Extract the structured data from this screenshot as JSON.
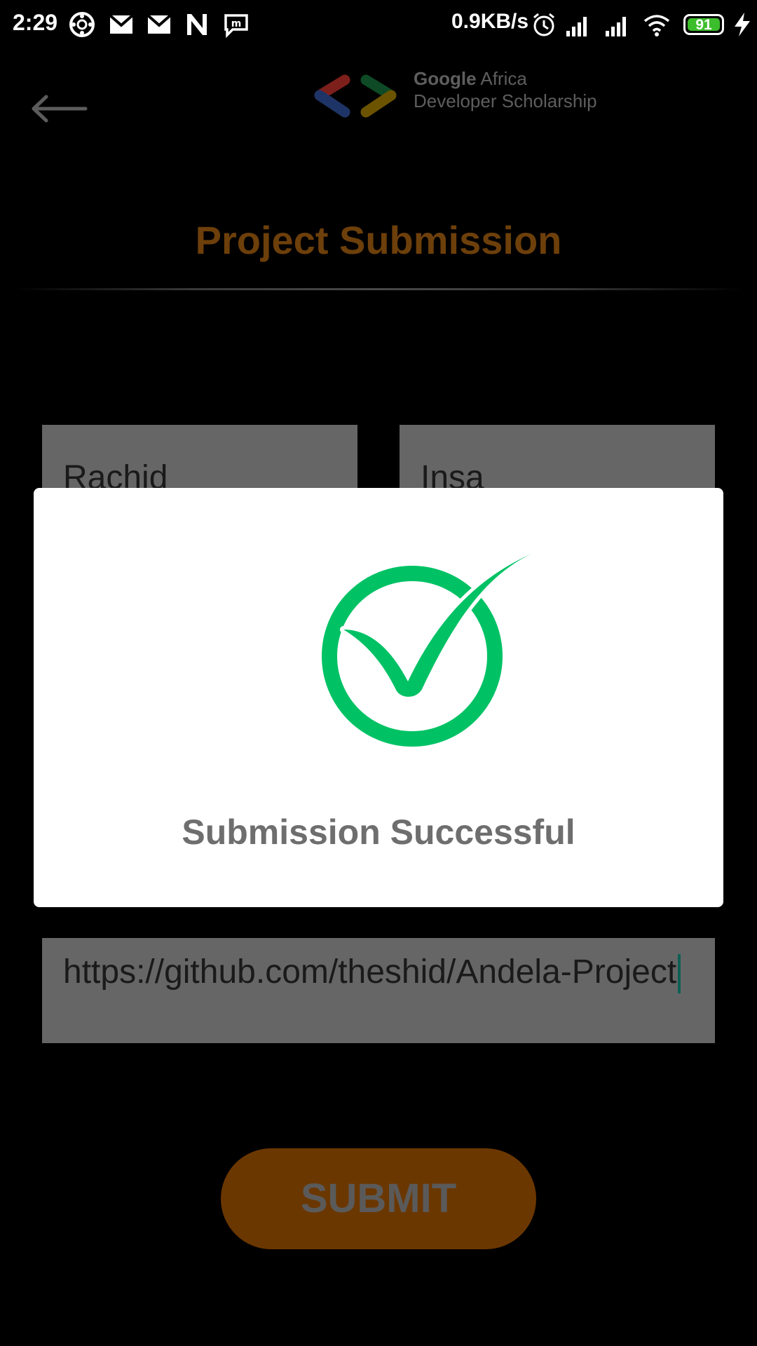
{
  "status_bar": {
    "time": "2:29",
    "net_speed": "0.9KB/s",
    "battery_level": "91",
    "icons": [
      "app-icon",
      "gmail-icon",
      "gmail-icon",
      "n-icon",
      "message-icon",
      "alarm-icon",
      "signal-icon",
      "signal-icon",
      "wifi-icon",
      "battery-icon",
      "charging-icon"
    ]
  },
  "header": {
    "brand_line1_bold": "Google",
    "brand_line1_rest": "Africa",
    "brand_line2": "Developer Scholarship"
  },
  "page": {
    "title": "Project Submission"
  },
  "form": {
    "first_name_value": "Rachid",
    "last_name_value": "Insa",
    "link_value": "https://github.com/theshid/Andela-Project",
    "submit_label": "SUBMIT"
  },
  "dialog": {
    "message": "Submission Successful"
  },
  "colors": {
    "background": "#000000",
    "title": "#6d3f0a",
    "submit": "#6b3700",
    "success": "#00c265"
  }
}
